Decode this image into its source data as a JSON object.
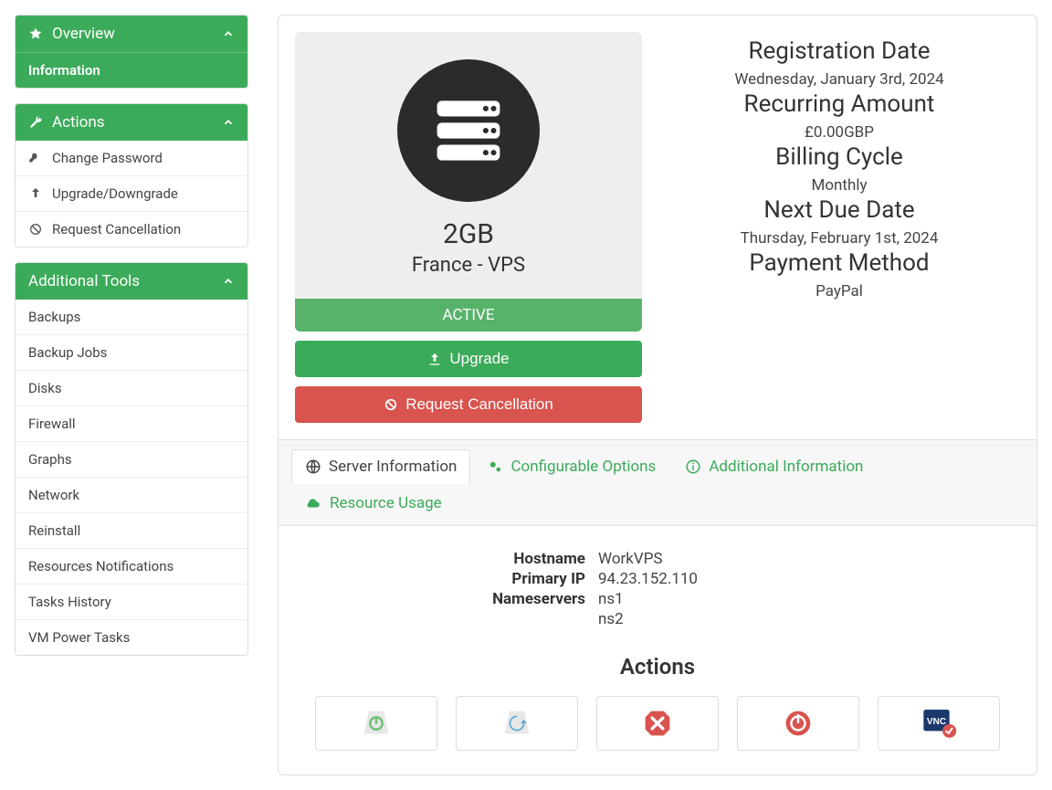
{
  "sidebar": {
    "overview": {
      "title": "Overview",
      "information": "Information"
    },
    "actions": {
      "title": "Actions",
      "items": [
        {
          "label": "Change Password"
        },
        {
          "label": "Upgrade/Downgrade"
        },
        {
          "label": "Request Cancellation"
        }
      ]
    },
    "tools": {
      "title": "Additional Tools",
      "items": [
        {
          "label": "Backups"
        },
        {
          "label": "Backup Jobs"
        },
        {
          "label": "Disks"
        },
        {
          "label": "Firewall"
        },
        {
          "label": "Graphs"
        },
        {
          "label": "Network"
        },
        {
          "label": "Reinstall"
        },
        {
          "label": "Resources Notifications"
        },
        {
          "label": "Tasks History"
        },
        {
          "label": "VM Power Tasks"
        }
      ]
    }
  },
  "product": {
    "name": "2GB",
    "subtitle": "France - VPS",
    "status": "ACTIVE",
    "upgrade_label": "Upgrade",
    "cancel_label": "Request Cancellation"
  },
  "billing": {
    "reg_title": "Registration Date",
    "reg_val": "Wednesday, January 3rd, 2024",
    "recur_title": "Recurring Amount",
    "recur_val": "£0.00GBP",
    "cycle_title": "Billing Cycle",
    "cycle_val": "Monthly",
    "due_title": "Next Due Date",
    "due_val": "Thursday, February 1st, 2024",
    "pay_title": "Payment Method",
    "pay_val": "PayPal"
  },
  "tabs": {
    "server_info": "Server Information",
    "config_opts": "Configurable Options",
    "addl_info": "Additional Information",
    "resource": "Resource Usage"
  },
  "server": {
    "hostname_label": "Hostname",
    "hostname": "WorkVPS",
    "ip_label": "Primary IP",
    "ip": "94.23.152.110",
    "ns_label": "Nameservers",
    "ns1": "ns1",
    "ns2": "ns2"
  },
  "actions_section": {
    "title": "Actions"
  }
}
